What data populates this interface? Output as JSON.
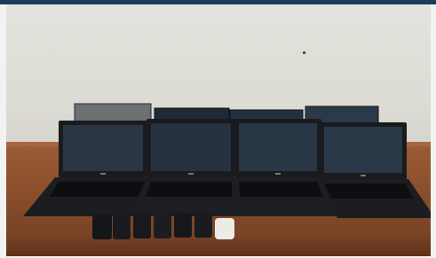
{
  "image": {
    "description_colors": {
      "topbar": "#1e3a5a",
      "wall": "#dedcd5",
      "table": "#8a4f2c",
      "laptop_body": "#1c1d20",
      "screen": "#2b3a4a",
      "keyboard": "#111214"
    },
    "icons": [
      "laptop-icon",
      "phone-icon",
      "power-bank-icon"
    ]
  }
}
